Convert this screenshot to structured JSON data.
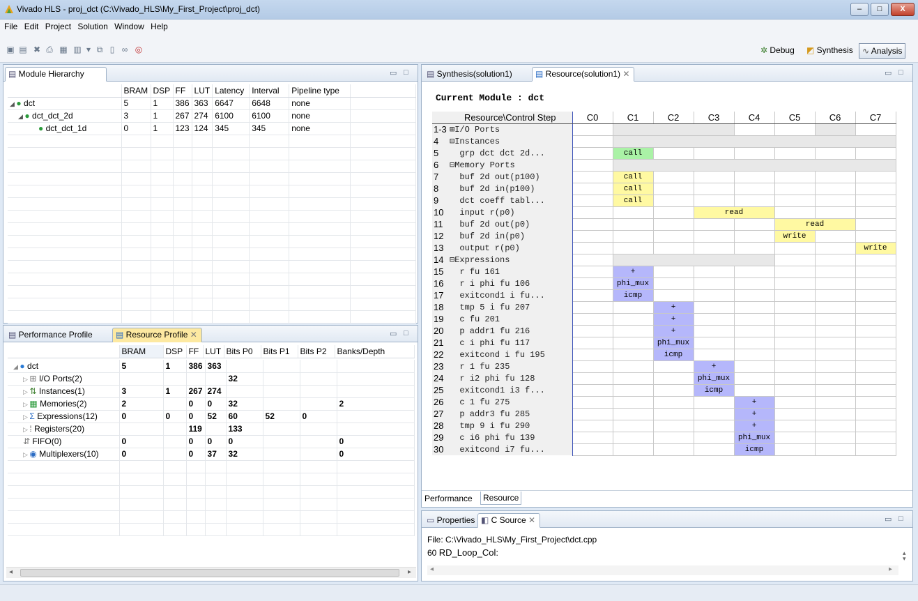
{
  "window": {
    "title": "Vivado HLS - proj_dct (C:\\Vivado_HLS\\My_First_Project\\proj_dct)",
    "minimize": "–",
    "maximize": "□",
    "close": "X"
  },
  "menu": [
    "File",
    "Edit",
    "Project",
    "Solution",
    "Window",
    "Help"
  ],
  "perspectives": {
    "debug": "Debug",
    "synthesis": "Synthesis",
    "analysis": "Analysis"
  },
  "module_hierarchy": {
    "tab": "Module Hierarchy",
    "columns": [
      "",
      "BRAM",
      "DSP",
      "FF",
      "LUT",
      "Latency",
      "Interval",
      "Pipeline type"
    ],
    "rows": [
      {
        "name": "dct",
        "bram": "5",
        "dsp": "1",
        "ff": "386",
        "lut": "363",
        "latency": "6647",
        "interval": "6648",
        "pipeline": "none"
      },
      {
        "name": "dct_dct_2d",
        "bram": "3",
        "dsp": "1",
        "ff": "267",
        "lut": "274",
        "latency": "6100",
        "interval": "6100",
        "pipeline": "none"
      },
      {
        "name": "dct_dct_1d",
        "bram": "0",
        "dsp": "1",
        "ff": "123",
        "lut": "124",
        "latency": "345",
        "interval": "345",
        "pipeline": "none"
      }
    ]
  },
  "profile": {
    "tab_performance": "Performance Profile",
    "tab_resource": "Resource Profile",
    "columns": [
      "",
      "BRAM",
      "DSP",
      "FF",
      "LUT",
      "Bits P0",
      "Bits P1",
      "Bits P2",
      "Banks/Depth"
    ],
    "rows": [
      {
        "name": "dct",
        "bram": "5",
        "dsp": "1",
        "ff": "386",
        "lut": "363",
        "p0": "",
        "p1": "",
        "p2": "",
        "banks": ""
      },
      {
        "name": "I/O Ports(2)",
        "bram": "",
        "dsp": "",
        "ff": "",
        "lut": "",
        "p0": "32",
        "p1": "",
        "p2": "",
        "banks": ""
      },
      {
        "name": "Instances(1)",
        "bram": "3",
        "dsp": "1",
        "ff": "267",
        "lut": "274",
        "p0": "",
        "p1": "",
        "p2": "",
        "banks": ""
      },
      {
        "name": "Memories(2)",
        "bram": "2",
        "dsp": "",
        "ff": "0",
        "lut": "0",
        "p0": "32",
        "p1": "",
        "p2": "",
        "banks": "2"
      },
      {
        "name": "Expressions(12)",
        "bram": "0",
        "dsp": "0",
        "ff": "0",
        "lut": "52",
        "p0": "60",
        "p1": "52",
        "p2": "0",
        "banks": ""
      },
      {
        "name": "Registers(20)",
        "bram": "",
        "dsp": "",
        "ff": "119",
        "lut": "",
        "p0": "133",
        "p1": "",
        "p2": "",
        "banks": ""
      },
      {
        "name": "FIFO(0)",
        "bram": "0",
        "dsp": "",
        "ff": "0",
        "lut": "0",
        "p0": "0",
        "p1": "",
        "p2": "",
        "banks": "0"
      },
      {
        "name": "Multiplexers(10)",
        "bram": "0",
        "dsp": "",
        "ff": "0",
        "lut": "37",
        "p0": "32",
        "p1": "",
        "p2": "",
        "banks": "0"
      }
    ]
  },
  "editor": {
    "tab_synthesis": "Synthesis(solution1)",
    "tab_resource": "Resource(solution1)",
    "current_module": "Current Module : dct",
    "header_name": "Resource\\Control Step",
    "steps": [
      "C0",
      "C1",
      "C2",
      "C3",
      "C4",
      "C5",
      "C6",
      "C7"
    ],
    "rows": [
      {
        "num": "1-3",
        "name": "⊞I/O Ports"
      },
      {
        "num": "4",
        "name": "⊟Instances"
      },
      {
        "num": "5",
        "name": "  grp dct dct 2d..."
      },
      {
        "num": "6",
        "name": "⊟Memory Ports"
      },
      {
        "num": "7",
        "name": "  buf 2d out(p100)"
      },
      {
        "num": "8",
        "name": "  buf 2d in(p100)"
      },
      {
        "num": "9",
        "name": "  dct coeff tabl..."
      },
      {
        "num": "10",
        "name": "  input r(p0)"
      },
      {
        "num": "11",
        "name": "  buf 2d out(p0)"
      },
      {
        "num": "12",
        "name": "  buf 2d in(p0)"
      },
      {
        "num": "13",
        "name": "  output r(p0)"
      },
      {
        "num": "14",
        "name": "⊟Expressions"
      },
      {
        "num": "15",
        "name": "  r fu 161"
      },
      {
        "num": "16",
        "name": "  r i phi fu 106"
      },
      {
        "num": "17",
        "name": "  exitcond1 i fu..."
      },
      {
        "num": "18",
        "name": "  tmp 5 i fu 207"
      },
      {
        "num": "19",
        "name": "  c fu 201"
      },
      {
        "num": "20",
        "name": "  p addr1 fu 216"
      },
      {
        "num": "21",
        "name": "  c i phi fu 117"
      },
      {
        "num": "22",
        "name": "  exitcond i fu 195"
      },
      {
        "num": "23",
        "name": "  r 1 fu 235"
      },
      {
        "num": "24",
        "name": "  r i2 phi fu 128"
      },
      {
        "num": "25",
        "name": "  exitcond1 i3 f..."
      },
      {
        "num": "26",
        "name": "  c 1 fu 275"
      },
      {
        "num": "27",
        "name": "  p addr3 fu 285"
      },
      {
        "num": "28",
        "name": "  tmp 9 i fu 290"
      },
      {
        "num": "29",
        "name": "  c i6 phi fu 139"
      },
      {
        "num": "30",
        "name": "  exitcond i7 fu..."
      }
    ],
    "ops": {
      "call": "call",
      "read": "read",
      "write": "write",
      "plus": "+",
      "phi_mux": "phi_mux",
      "icmp": "icmp"
    },
    "bottom_tabs": [
      "Performance",
      "Resource"
    ]
  },
  "properties": {
    "tab_properties": "Properties",
    "tab_csource": "C Source",
    "file": "File: C:\\Vivado_HLS\\My_First_Project\\dct.cpp",
    "line_num": "60",
    "line_text": "RD_Loop_Col:"
  }
}
